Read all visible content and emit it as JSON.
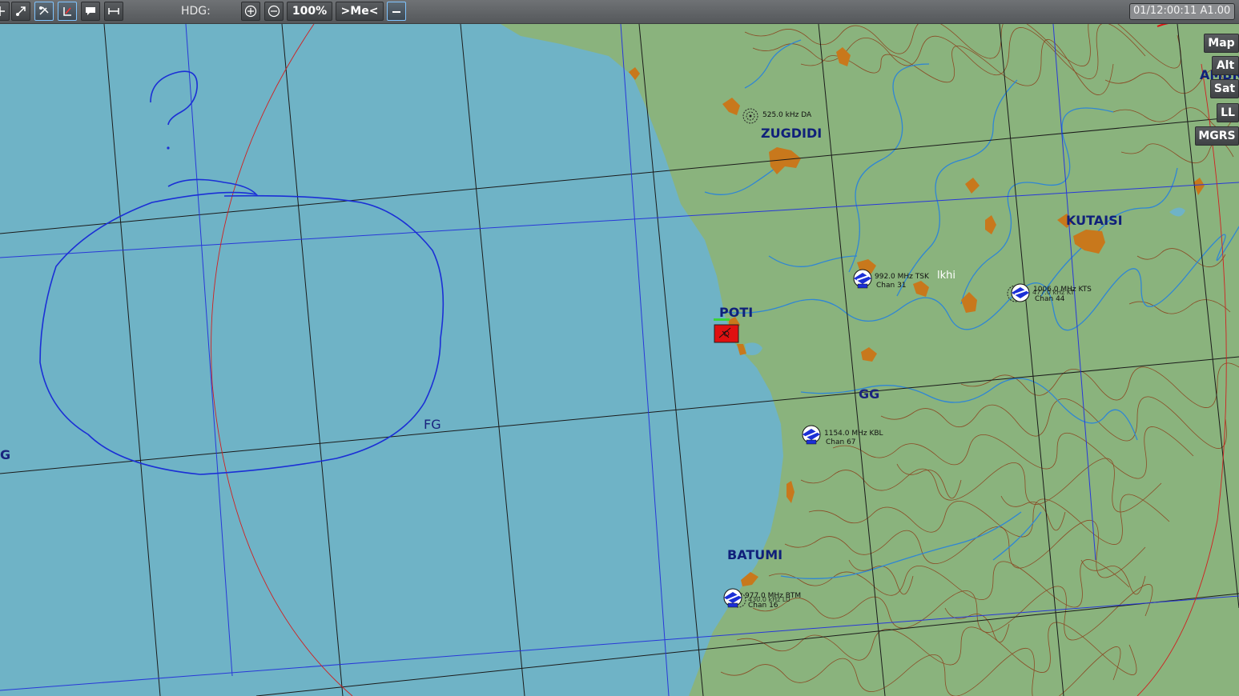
{
  "toolbar": {
    "hdg_label": "HDG:",
    "zoom_label": "100%",
    "center_me_label": ">Me<",
    "tool_icons": [
      "move-icon",
      "select-icon",
      "map-layers-icon",
      "labels-icon",
      "comment-icon",
      "ruler-icon",
      "zoom-in-icon",
      "zoom-out-icon",
      "minimize-icon"
    ]
  },
  "time_display": "01/12:00:11 A1.00",
  "view_buttons": {
    "map": "Map",
    "alt": "Alt",
    "sat": "Sat",
    "ll": "LL",
    "mgrs": "MGRS"
  },
  "map": {
    "grid_labels": {
      "fg": "FG",
      "gg": "GG",
      "g": "G"
    },
    "cities": {
      "zugdidi": "ZUGDIDI",
      "poti": "POTI",
      "kutaisi": "KUTAISI",
      "batumi": "BATUMI"
    },
    "partial_labels": {
      "ambr": "AMBR",
      "lkhi": "lkhi"
    },
    "navaids": {
      "zugdidi_ndb": "525.0 kHz DA",
      "senaki_freq": "992.0 MHz TSK",
      "senaki_chan": "Chan 31",
      "kutaisi_freq": "1006.0 MHz KTS",
      "kutaisi_ndb": "477.0 kHz KT",
      "kutaisi_chan": "Chan 44",
      "kobuleti_freq": "1154.0 MHz KBL",
      "kobuleti_chan": "Chan 67",
      "batumi_freq": "977.0 MHz BTM",
      "batumi_ndb": "430.0 kHz LU",
      "batumi_chan": "Chan 16"
    },
    "colors": {
      "sea": "#6fb3c6",
      "land": "#8ab37d",
      "city": "#c8781c",
      "river": "#2f86d4",
      "contour": "#8a4a24",
      "grid_black": "#1a1a1a",
      "grid_blue": "#2838d8",
      "drawing": "#1b2fd6",
      "unit_red": "#e01010"
    }
  }
}
